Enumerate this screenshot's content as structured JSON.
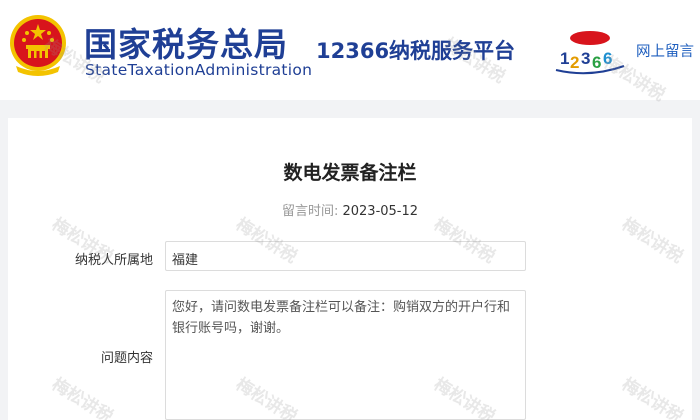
{
  "header": {
    "brand_cn": "国家税务总局",
    "brand_en": "StateTaxationAdministration",
    "platform_title": "12366纳税服务平台",
    "nav_link": "网上留言"
  },
  "content": {
    "title": "数电发票备注栏",
    "date_label": "留言时间:",
    "date_value": "2023-05-12",
    "fields": {
      "region_label": "纳税人所属地",
      "region_value": "福建",
      "question_label": "问题内容",
      "question_value": "您好，请问数电发票备注栏可以备注：购销双方的开户行和银行账号吗，谢谢。"
    }
  },
  "watermark": {
    "text": "梅松讲税"
  },
  "colors": {
    "brand_blue": "#1f3f95",
    "link_blue": "#1f5fbf",
    "emblem_red": "#d8141c",
    "emblem_gold": "#f3c300"
  }
}
